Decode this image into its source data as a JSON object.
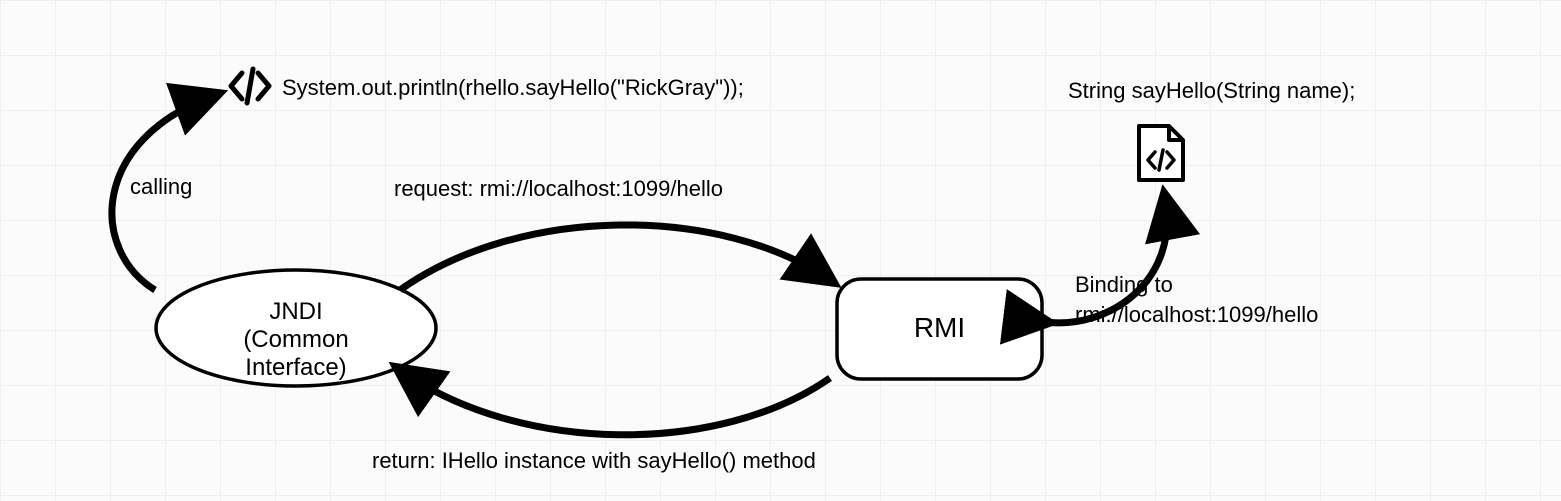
{
  "nodes": {
    "jndi": {
      "line1": "JNDI",
      "line2": "(Common Interface)"
    },
    "rmi": {
      "label": "RMI"
    }
  },
  "code_caller": "System.out.println(rhello.sayHello(\"RickGray\"));",
  "code_interface": "String sayHello(String name);",
  "labels": {
    "calling": "calling",
    "request": "request: rmi://localhost:1099/hello",
    "return": "return: IHello instance with sayHello() method",
    "binding_l1": "Binding to",
    "binding_l2": "rmi://localhost:1099/hello"
  }
}
